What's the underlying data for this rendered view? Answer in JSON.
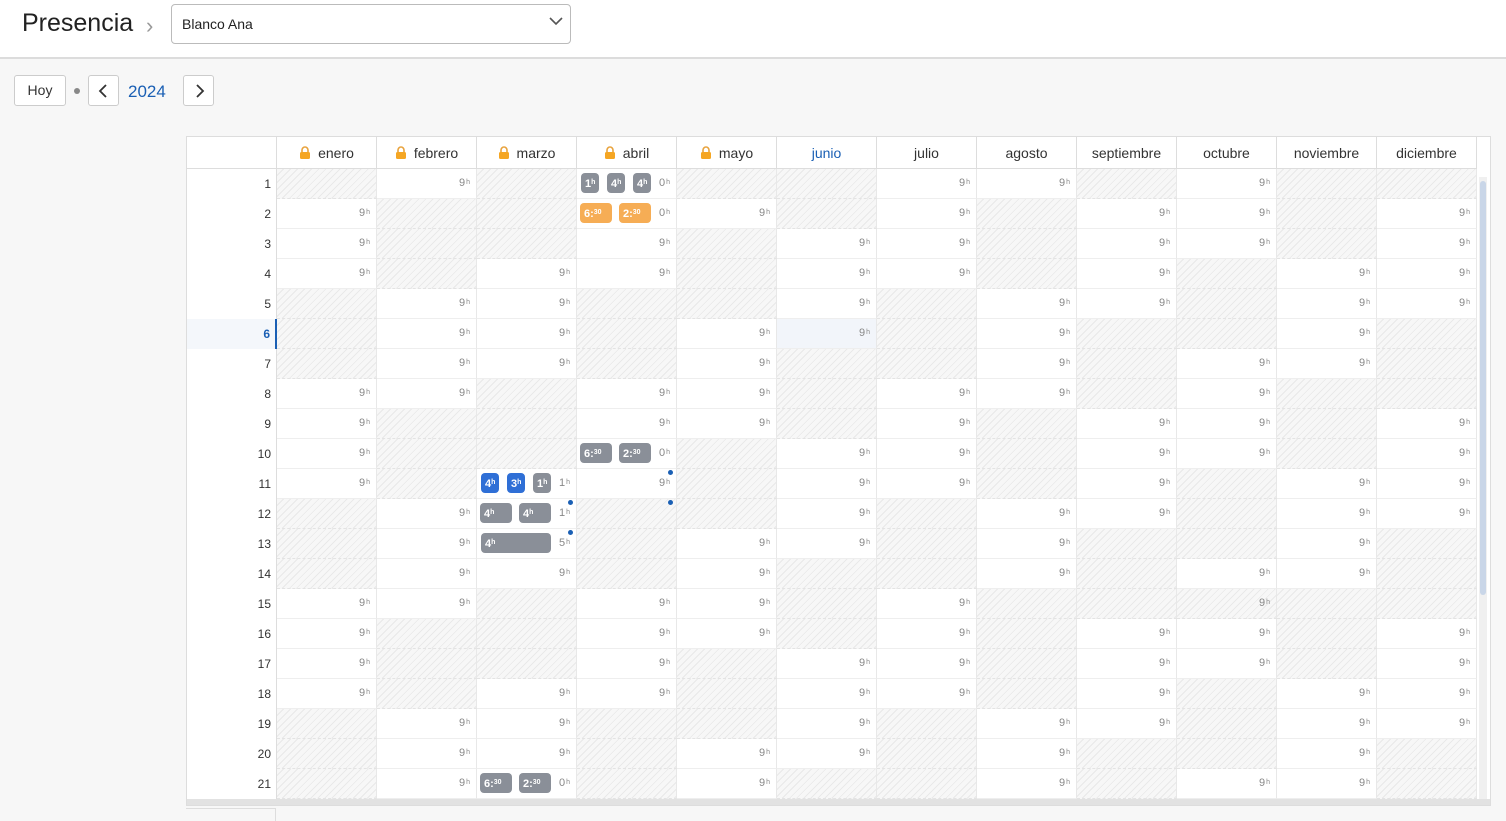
{
  "header": {
    "title": "Presencia",
    "crumb": "›",
    "employee": "Blanco Ana"
  },
  "toolbar": {
    "today": "Hoy",
    "year": "2024"
  },
  "months": [
    {
      "name": "enero",
      "locked": true
    },
    {
      "name": "febrero",
      "locked": true
    },
    {
      "name": "marzo",
      "locked": true
    },
    {
      "name": "abril",
      "locked": true
    },
    {
      "name": "mayo",
      "locked": true
    },
    {
      "name": "junio",
      "locked": false,
      "current": true
    },
    {
      "name": "julio",
      "locked": false
    },
    {
      "name": "agosto",
      "locked": false
    },
    {
      "name": "septiembre",
      "locked": false
    },
    {
      "name": "octubre",
      "locked": false
    },
    {
      "name": "noviembre",
      "locked": false
    },
    {
      "name": "diciembre",
      "locked": false
    }
  ],
  "current_day": 6,
  "hour_unit": "h",
  "days": [
    {
      "d": "1",
      "v": [
        "",
        "9",
        "",
        "0",
        "",
        "",
        "9",
        "9",
        "",
        "9",
        "",
        ""
      ]
    },
    {
      "d": "2",
      "v": [
        "9",
        "",
        "",
        "0",
        "9",
        "",
        "9",
        "",
        "9",
        "9",
        "",
        "9"
      ]
    },
    {
      "d": "3",
      "v": [
        "9",
        "",
        "",
        "9",
        "",
        "9",
        "9",
        "",
        "9",
        "9",
        "",
        "9"
      ]
    },
    {
      "d": "4",
      "v": [
        "9",
        "",
        "9",
        "9",
        "",
        "9",
        "9",
        "",
        "9",
        "",
        "9",
        "9"
      ]
    },
    {
      "d": "5",
      "v": [
        "",
        "9",
        "9",
        "",
        "",
        "9",
        "",
        "9",
        "9",
        "",
        "9",
        "9"
      ]
    },
    {
      "d": "6",
      "v": [
        "",
        "9",
        "9",
        "",
        "9",
        "9",
        "",
        "9",
        "",
        "",
        "9",
        ""
      ]
    },
    {
      "d": "7",
      "v": [
        "",
        "9",
        "9",
        "",
        "9",
        "",
        "",
        "9",
        "",
        "9",
        "9",
        ""
      ]
    },
    {
      "d": "8",
      "v": [
        "9",
        "9",
        "",
        "9",
        "9",
        "",
        "9",
        "9",
        "",
        "9",
        "",
        ""
      ]
    },
    {
      "d": "9",
      "v": [
        "9",
        "",
        "",
        "9",
        "9",
        "",
        "9",
        "",
        "9",
        "9",
        "",
        "9"
      ]
    },
    {
      "d": "10",
      "v": [
        "9",
        "",
        "",
        "0",
        "",
        "9",
        "9",
        "",
        "9",
        "9",
        "",
        "9"
      ]
    },
    {
      "d": "11",
      "v": [
        "9",
        "",
        "1",
        "9",
        "",
        "9",
        "9",
        "",
        "9",
        "",
        "9",
        "9"
      ]
    },
    {
      "d": "12",
      "v": [
        "",
        "9",
        "1",
        "",
        "",
        "9",
        "",
        "9",
        "9",
        "",
        "9",
        "9"
      ]
    },
    {
      "d": "13",
      "v": [
        "",
        "9",
        "5",
        "",
        "9",
        "9",
        "",
        "9",
        "",
        "",
        "9",
        ""
      ]
    },
    {
      "d": "14",
      "v": [
        "",
        "9",
        "9",
        "",
        "9",
        "",
        "",
        "9",
        "",
        "9",
        "9",
        ""
      ]
    },
    {
      "d": "15",
      "v": [
        "9",
        "9",
        "",
        "9",
        "9",
        "",
        "9",
        "",
        "",
        "9",
        "",
        ""
      ]
    },
    {
      "d": "16",
      "v": [
        "9",
        "",
        "",
        "9",
        "9",
        "",
        "9",
        "",
        "9",
        "9",
        "",
        "9"
      ]
    },
    {
      "d": "17",
      "v": [
        "9",
        "",
        "",
        "9",
        "",
        "9",
        "9",
        "",
        "9",
        "9",
        "",
        "9"
      ]
    },
    {
      "d": "18",
      "v": [
        "9",
        "",
        "9",
        "9",
        "",
        "9",
        "9",
        "",
        "9",
        "",
        "9",
        "9"
      ]
    },
    {
      "d": "19",
      "v": [
        "",
        "9",
        "9",
        "",
        "",
        "9",
        "",
        "9",
        "9",
        "",
        "9",
        "9"
      ]
    },
    {
      "d": "20",
      "v": [
        "",
        "9",
        "9",
        "",
        "9",
        "9",
        "",
        "9",
        "",
        "",
        "9",
        ""
      ]
    },
    {
      "d": "21",
      "v": [
        "",
        "9",
        "0",
        "",
        "9",
        "",
        "",
        "9",
        "",
        "9",
        "9",
        ""
      ]
    }
  ],
  "off_days": {
    "0": [
      1,
      5,
      6,
      7,
      12,
      13,
      14,
      19,
      20,
      21
    ],
    "1": [
      2,
      3,
      4,
      9,
      10,
      11,
      16,
      17,
      18
    ],
    "2": [
      1,
      2,
      3,
      8,
      9,
      10,
      15,
      16,
      17
    ],
    "3": [
      5,
      6,
      7,
      12,
      13,
      14,
      19,
      20,
      21
    ],
    "4": [
      1,
      3,
      4,
      5,
      10,
      11,
      12,
      17,
      18,
      19
    ],
    "5": [
      1,
      2,
      7,
      8,
      9,
      14,
      15,
      16,
      21
    ],
    "6": [
      5,
      6,
      7,
      12,
      13,
      14,
      19,
      20,
      21
    ],
    "7": [
      2,
      3,
      4,
      9,
      10,
      11,
      15,
      16,
      17,
      18
    ],
    "8": [
      1,
      6,
      7,
      8,
      13,
      14,
      15,
      20,
      21
    ],
    "9": [
      4,
      5,
      6,
      11,
      12,
      13,
      15,
      18,
      19,
      20
    ],
    "10": [
      1,
      2,
      3,
      8,
      9,
      10,
      15,
      16,
      17
    ],
    "11": [
      1,
      6,
      7,
      8,
      13,
      14,
      15,
      20,
      21
    ]
  },
  "entries": [
    {
      "m": 3,
      "d": 1,
      "items": [
        {
          "t": "1",
          "u": "h",
          "c": "g"
        },
        {
          "t": "4",
          "u": "h",
          "c": "g"
        },
        {
          "t": "4",
          "u": "h",
          "c": "g"
        }
      ]
    },
    {
      "m": 3,
      "d": 2,
      "items": [
        {
          "t": "6:",
          "u": "30",
          "c": "o"
        },
        {
          "t": "2:",
          "u": "30",
          "c": "o"
        }
      ]
    },
    {
      "m": 3,
      "d": 10,
      "items": [
        {
          "t": "6:",
          "u": "30",
          "c": "g"
        },
        {
          "t": "2:",
          "u": "30",
          "c": "g"
        }
      ]
    },
    {
      "m": 2,
      "d": 11,
      "items": [
        {
          "t": "4",
          "u": "h",
          "c": "bl"
        },
        {
          "t": "3",
          "u": "h",
          "c": "bl"
        },
        {
          "t": "1",
          "u": "h",
          "c": "g"
        }
      ]
    },
    {
      "m": 2,
      "d": 12,
      "items": [
        {
          "t": "4",
          "u": "h",
          "c": "g"
        },
        {
          "t": "4",
          "u": "h",
          "c": "g"
        }
      ]
    },
    {
      "m": 2,
      "d": 13,
      "items": [
        {
          "t": "4",
          "u": "h",
          "c": "g",
          "wide": true
        }
      ]
    },
    {
      "m": 2,
      "d": 21,
      "items": [
        {
          "t": "6:",
          "u": "30",
          "c": "g"
        },
        {
          "t": "2:",
          "u": "30",
          "c": "g"
        }
      ]
    }
  ],
  "colors": {
    "accent": "#1a5fb4",
    "pending": "#f6ad55",
    "approved": "#8a8f98",
    "blue": "#2f6fd6"
  }
}
